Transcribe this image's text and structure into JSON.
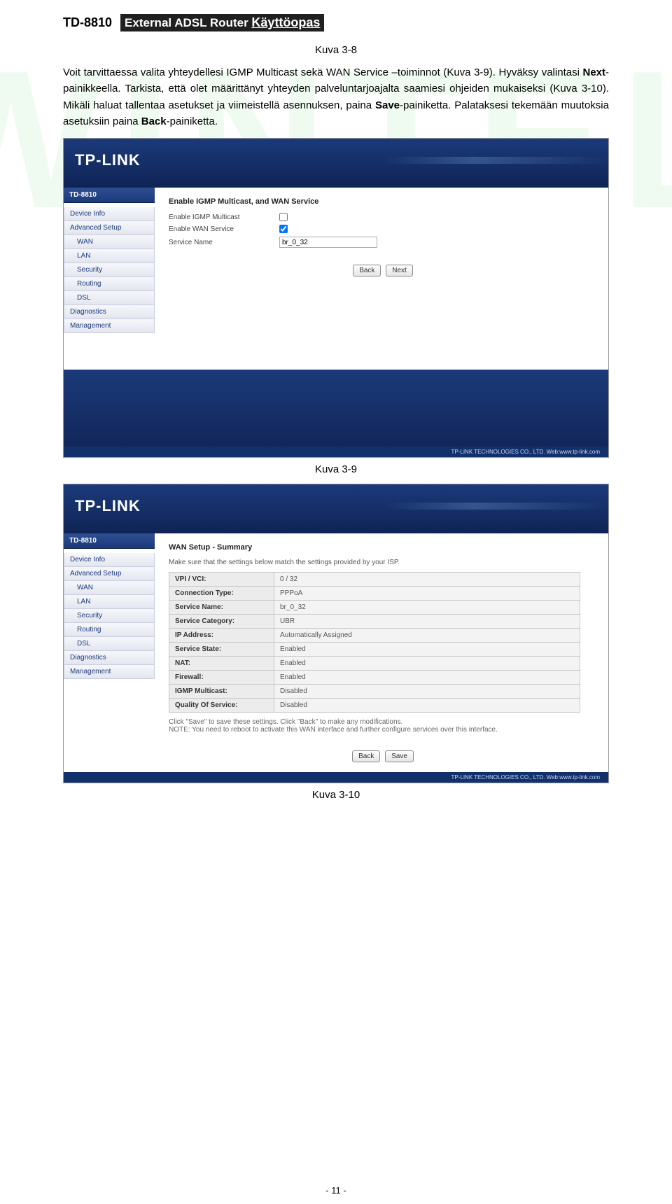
{
  "header": {
    "model": "TD-8810",
    "titleBar": "External ADSL Router",
    "titleRest": "Käyttöopas"
  },
  "captions": {
    "top": "Kuva 3-8",
    "mid": "Kuva 3-9",
    "bottom": "Kuva 3-10"
  },
  "para": {
    "a1": "Voit tarvittaessa valita yhteydellesi IGMP Multicast sekä WAN Service –toiminnot (Kuva 3-9). Hyväksy valintasi ",
    "a_b1": "Next",
    "a2": "-painikkeella. Tarkista, että olet määrittänyt yhteyden palveluntarjoajalta saamiesi ohjeiden mukaiseksi (Kuva 3-10). Mikäli haluat tallentaa asetukset ja viimeistellä asennuksen, paina ",
    "a_b2": "Save",
    "a3": "-painiketta. Palataksesi tekemään muutoksia asetuksiin paina ",
    "a_b3": "Back",
    "a4": "-painiketta."
  },
  "brand": "TP-LINK",
  "modelHead": "TD-8810",
  "menu": {
    "deviceInfo": "Device Info",
    "advanced": "Advanced Setup",
    "wan": "WAN",
    "lan": "LAN",
    "security": "Security",
    "routing": "Routing",
    "dsl": "DSL",
    "diagnostics": "Diagnostics",
    "management": "Management"
  },
  "shot1": {
    "heading": "Enable IGMP Multicast, and WAN Service",
    "l1": "Enable IGMP Multicast",
    "l2": "Enable WAN Service",
    "l3": "Service Name",
    "svc": "br_0_32",
    "back": "Back",
    "next": "Next"
  },
  "shot2": {
    "heading": "WAN Setup - Summary",
    "intro": "Make sure that the settings below match the settings provided by your ISP.",
    "rows": [
      [
        "VPI / VCI:",
        "0 / 32"
      ],
      [
        "Connection Type:",
        "PPPoA"
      ],
      [
        "Service Name:",
        "br_0_32"
      ],
      [
        "Service Category:",
        "UBR"
      ],
      [
        "IP Address:",
        "Automatically Assigned"
      ],
      [
        "Service State:",
        "Enabled"
      ],
      [
        "NAT:",
        "Enabled"
      ],
      [
        "Firewall:",
        "Enabled"
      ],
      [
        "IGMP Multicast:",
        "Disabled"
      ],
      [
        "Quality Of Service:",
        "Disabled"
      ]
    ],
    "note1": "Click \"Save\" to save these settings. Click \"Back\" to make any modifications.",
    "note2": "NOTE: You need to reboot to activate this WAN interface and further configure services over this interface.",
    "back": "Back",
    "save": "Save"
  },
  "footerline": "TP-LINK TECHNOLOGIES CO., LTD. Web:www.tp-link.com",
  "pageNumber": "- 11 -"
}
